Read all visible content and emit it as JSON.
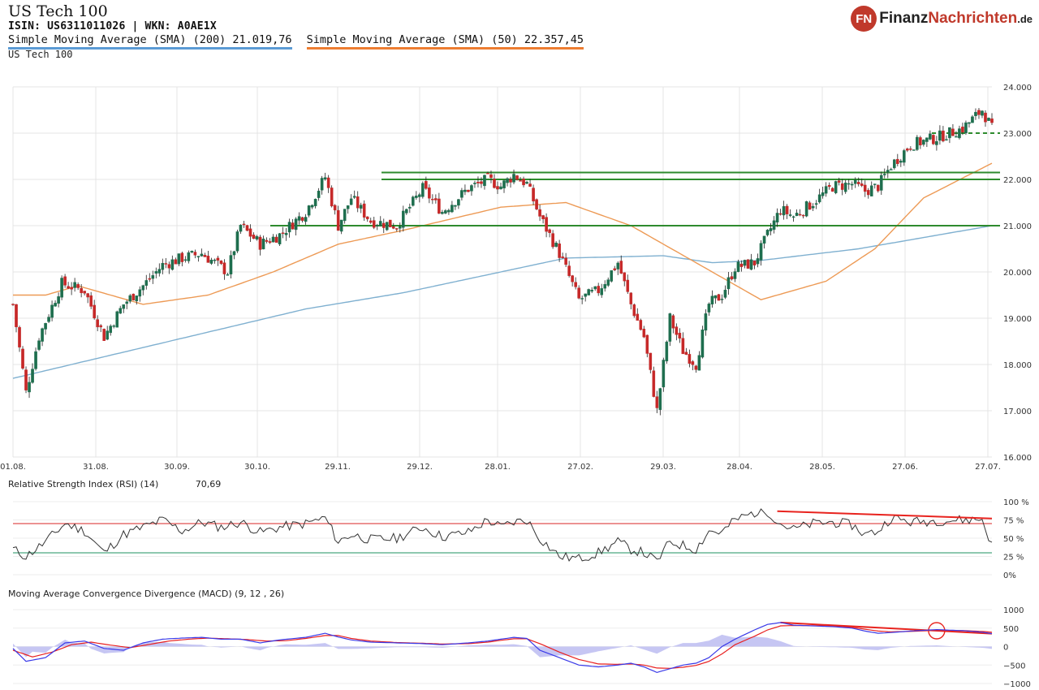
{
  "header": {
    "title": "US Tech 100",
    "isin_line": "ISIN: US6311011026  | WKN: A0AE1X",
    "legend": [
      {
        "label": "Simple Moving Average (SMA) (200) 21.019,76",
        "color": "#5b9bd5"
      },
      {
        "label": "Simple Moving Average (SMA) (50) 22.357,45",
        "color": "#ed7d31"
      }
    ],
    "series_name": "US Tech 100"
  },
  "logo": {
    "badge": "FN",
    "part1": "Finanz",
    "part2": "Nachrichten",
    "suffix": ".de"
  },
  "rsi_label": "Relative Strength Index (RSI) (14)",
  "rsi_value": "70,69",
  "macd_label": "Moving Average Convergence Divergence (MACD) (9, 12 , 26)",
  "colors": {
    "up": "#1e6e4e",
    "down": "#c62828",
    "sma200": "#7fb0d0",
    "sma50": "#ed9a55",
    "support": "#2e8b2e",
    "trend": "#e8231e",
    "rsi_line": "#333333",
    "macd_line": "#3a3ae8",
    "signal_line": "#e82020",
    "hist": "#b8b8f0"
  },
  "chart_data": [
    {
      "type": "candlestick",
      "title": "US Tech 100",
      "x_ticks": [
        "01.08.",
        "31.08.",
        "30.09.",
        "30.10.",
        "29.11.",
        "29.12.",
        "28.01.",
        "27.02.",
        "29.03.",
        "28.04.",
        "28.05.",
        "27.06.",
        "27.07."
      ],
      "y_ticks": [
        "24.000",
        "23.000",
        "22.000",
        "21.000",
        "20.000",
        "19.000",
        "18.000",
        "17.000",
        "16.000"
      ],
      "ylim": [
        16000,
        24000
      ],
      "grid": true,
      "waypoints": [
        [
          0,
          19300
        ],
        [
          4,
          17400
        ],
        [
          8,
          18600
        ],
        [
          15,
          19750
        ],
        [
          22,
          19600
        ],
        [
          28,
          18600
        ],
        [
          34,
          19300
        ],
        [
          40,
          19700
        ],
        [
          46,
          20150
        ],
        [
          52,
          20300
        ],
        [
          58,
          20400
        ],
        [
          62,
          20200
        ],
        [
          66,
          20000
        ],
        [
          70,
          21000
        ],
        [
          76,
          20600
        ],
        [
          82,
          20800
        ],
        [
          90,
          21300
        ],
        [
          96,
          22050
        ],
        [
          100,
          21000
        ],
        [
          104,
          21600
        ],
        [
          110,
          21100
        ],
        [
          118,
          21000
        ],
        [
          126,
          21800
        ],
        [
          132,
          21300
        ],
        [
          140,
          21800
        ],
        [
          146,
          22000
        ],
        [
          150,
          21850
        ],
        [
          154,
          22100
        ],
        [
          158,
          21900
        ],
        [
          162,
          21200
        ],
        [
          168,
          20400
        ],
        [
          174,
          19400
        ],
        [
          180,
          19600
        ],
        [
          186,
          20200
        ],
        [
          190,
          19300
        ],
        [
          194,
          18600
        ],
        [
          198,
          17000
        ],
        [
          202,
          19000
        ],
        [
          206,
          18300
        ],
        [
          210,
          18000
        ],
        [
          214,
          19300
        ],
        [
          218,
          19500
        ],
        [
          222,
          20100
        ],
        [
          228,
          20200
        ],
        [
          232,
          20800
        ],
        [
          236,
          21350
        ],
        [
          240,
          21200
        ],
        [
          246,
          21500
        ],
        [
          252,
          21850
        ],
        [
          258,
          21900
        ],
        [
          262,
          21750
        ],
        [
          266,
          21850
        ],
        [
          270,
          22300
        ],
        [
          276,
          22750
        ],
        [
          284,
          22900
        ],
        [
          292,
          23100
        ],
        [
          298,
          23500
        ],
        [
          301,
          23100
        ]
      ],
      "sma200": [
        [
          0,
          17700
        ],
        [
          30,
          18200
        ],
        [
          60,
          18700
        ],
        [
          90,
          19200
        ],
        [
          120,
          19550
        ],
        [
          150,
          20000
        ],
        [
          170,
          20300
        ],
        [
          200,
          20350
        ],
        [
          215,
          20200
        ],
        [
          230,
          20250
        ],
        [
          260,
          20500
        ],
        [
          301,
          21000
        ]
      ],
      "sma50": [
        [
          0,
          19500
        ],
        [
          10,
          19500
        ],
        [
          20,
          19700
        ],
        [
          40,
          19300
        ],
        [
          60,
          19500
        ],
        [
          80,
          20000
        ],
        [
          100,
          20600
        ],
        [
          120,
          20900
        ],
        [
          150,
          21400
        ],
        [
          170,
          21500
        ],
        [
          190,
          21000
        ],
        [
          210,
          20200
        ],
        [
          230,
          19400
        ],
        [
          250,
          19800
        ],
        [
          265,
          20500
        ],
        [
          280,
          21600
        ],
        [
          301,
          22350
        ]
      ],
      "support_levels": [
        22150,
        22000,
        21000
      ],
      "dashed_level": 23000
    },
    {
      "type": "line",
      "title": "Relative Strength Index (RSI) (14)",
      "last_value": 70.69,
      "y_ticks": [
        "100 %",
        "75 %",
        "50 %",
        "25 %",
        "0%"
      ],
      "ylim": [
        0,
        100
      ],
      "levels": [
        70,
        30
      ],
      "waypoints": [
        [
          0,
          35
        ],
        [
          4,
          25
        ],
        [
          10,
          45
        ],
        [
          16,
          70
        ],
        [
          22,
          60
        ],
        [
          28,
          30
        ],
        [
          34,
          55
        ],
        [
          40,
          65
        ],
        [
          46,
          75
        ],
        [
          52,
          60
        ],
        [
          58,
          72
        ],
        [
          64,
          65
        ],
        [
          70,
          72
        ],
        [
          76,
          58
        ],
        [
          82,
          65
        ],
        [
          90,
          70
        ],
        [
          96,
          78
        ],
        [
          100,
          45
        ],
        [
          104,
          55
        ],
        [
          110,
          48
        ],
        [
          118,
          50
        ],
        [
          126,
          65
        ],
        [
          132,
          52
        ],
        [
          140,
          58
        ],
        [
          146,
          75
        ],
        [
          150,
          65
        ],
        [
          154,
          72
        ],
        [
          158,
          75
        ],
        [
          162,
          50
        ],
        [
          168,
          25
        ],
        [
          174,
          22
        ],
        [
          180,
          30
        ],
        [
          186,
          45
        ],
        [
          190,
          35
        ],
        [
          194,
          30
        ],
        [
          198,
          18
        ],
        [
          202,
          45
        ],
        [
          206,
          40
        ],
        [
          210,
          35
        ],
        [
          214,
          60
        ],
        [
          218,
          58
        ],
        [
          222,
          75
        ],
        [
          228,
          85
        ],
        [
          232,
          87
        ],
        [
          236,
          70
        ],
        [
          240,
          62
        ],
        [
          246,
          70
        ],
        [
          252,
          72
        ],
        [
          258,
          68
        ],
        [
          262,
          55
        ],
        [
          266,
          60
        ],
        [
          270,
          78
        ],
        [
          276,
          72
        ],
        [
          284,
          74
        ],
        [
          292,
          75
        ],
        [
          298,
          76
        ],
        [
          301,
          40
        ]
      ],
      "trendline": [
        [
          235,
          87
        ],
        [
          301,
          77
        ]
      ]
    },
    {
      "type": "line",
      "title": "Moving Average Convergence Divergence (MACD) (9, 12 , 26)",
      "y_ticks": [
        "1000",
        "500",
        "0",
        "−500",
        "−1000"
      ],
      "ylim": [
        -1000,
        1000
      ],
      "macd": [
        [
          0,
          -50
        ],
        [
          4,
          -400
        ],
        [
          10,
          -300
        ],
        [
          16,
          100
        ],
        [
          22,
          150
        ],
        [
          28,
          -50
        ],
        [
          34,
          -100
        ],
        [
          40,
          100
        ],
        [
          46,
          200
        ],
        [
          52,
          230
        ],
        [
          58,
          250
        ],
        [
          64,
          200
        ],
        [
          70,
          200
        ],
        [
          76,
          100
        ],
        [
          82,
          180
        ],
        [
          90,
          250
        ],
        [
          96,
          360
        ],
        [
          100,
          260
        ],
        [
          104,
          180
        ],
        [
          110,
          120
        ],
        [
          118,
          100
        ],
        [
          126,
          80
        ],
        [
          132,
          50
        ],
        [
          140,
          100
        ],
        [
          146,
          150
        ],
        [
          150,
          200
        ],
        [
          154,
          250
        ],
        [
          158,
          220
        ],
        [
          162,
          -100
        ],
        [
          168,
          -300
        ],
        [
          174,
          -500
        ],
        [
          180,
          -550
        ],
        [
          186,
          -500
        ],
        [
          190,
          -450
        ],
        [
          194,
          -550
        ],
        [
          198,
          -700
        ],
        [
          202,
          -600
        ],
        [
          206,
          -500
        ],
        [
          210,
          -450
        ],
        [
          214,
          -300
        ],
        [
          218,
          0
        ],
        [
          222,
          200
        ],
        [
          228,
          450
        ],
        [
          232,
          600
        ],
        [
          236,
          650
        ],
        [
          240,
          580
        ],
        [
          246,
          560
        ],
        [
          252,
          540
        ],
        [
          258,
          500
        ],
        [
          262,
          420
        ],
        [
          266,
          360
        ],
        [
          270,
          380
        ],
        [
          276,
          420
        ],
        [
          284,
          460
        ],
        [
          292,
          430
        ],
        [
          298,
          390
        ],
        [
          301,
          350
        ]
      ],
      "signal": [
        [
          0,
          -100
        ],
        [
          6,
          -280
        ],
        [
          12,
          -150
        ],
        [
          18,
          50
        ],
        [
          24,
          120
        ],
        [
          30,
          40
        ],
        [
          36,
          -30
        ],
        [
          42,
          60
        ],
        [
          48,
          150
        ],
        [
          54,
          200
        ],
        [
          60,
          230
        ],
        [
          66,
          210
        ],
        [
          72,
          190
        ],
        [
          78,
          150
        ],
        [
          84,
          160
        ],
        [
          90,
          220
        ],
        [
          96,
          300
        ],
        [
          100,
          300
        ],
        [
          104,
          220
        ],
        [
          110,
          150
        ],
        [
          118,
          110
        ],
        [
          126,
          90
        ],
        [
          132,
          70
        ],
        [
          140,
          80
        ],
        [
          146,
          120
        ],
        [
          150,
          170
        ],
        [
          154,
          210
        ],
        [
          158,
          210
        ],
        [
          162,
          80
        ],
        [
          168,
          -150
        ],
        [
          174,
          -350
        ],
        [
          180,
          -470
        ],
        [
          186,
          -480
        ],
        [
          190,
          -470
        ],
        [
          194,
          -500
        ],
        [
          198,
          -580
        ],
        [
          202,
          -590
        ],
        [
          206,
          -560
        ],
        [
          210,
          -510
        ],
        [
          214,
          -400
        ],
        [
          218,
          -200
        ],
        [
          222,
          50
        ],
        [
          228,
          280
        ],
        [
          232,
          450
        ],
        [
          236,
          560
        ],
        [
          240,
          570
        ],
        [
          246,
          565
        ],
        [
          252,
          550
        ],
        [
          258,
          520
        ],
        [
          262,
          470
        ],
        [
          266,
          420
        ],
        [
          270,
          400
        ],
        [
          276,
          410
        ],
        [
          284,
          440
        ],
        [
          292,
          435
        ],
        [
          298,
          410
        ],
        [
          301,
          390
        ]
      ],
      "trendline": [
        [
          236,
          650
        ],
        [
          301,
          350
        ]
      ],
      "highlight_circle_x": 284
    }
  ]
}
